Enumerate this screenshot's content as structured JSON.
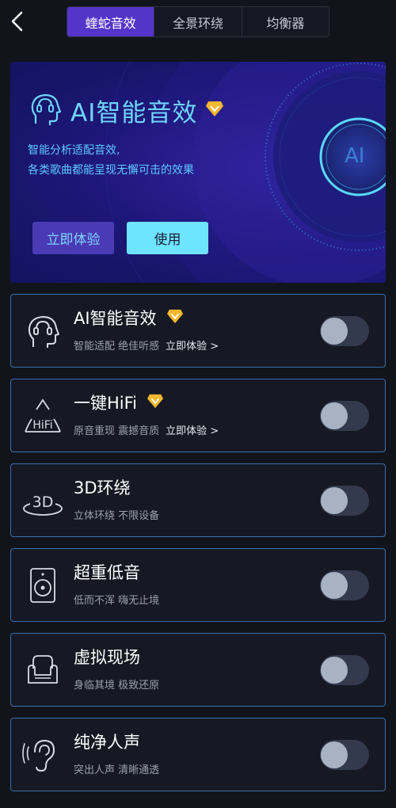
{
  "tabs": [
    {
      "label": "蝰蛇音效",
      "active": true
    },
    {
      "label": "全景环绕",
      "active": false
    },
    {
      "label": "均衡器",
      "active": false
    }
  ],
  "banner": {
    "title": "AI智能音效",
    "desc_line1": "智能分析适配音效,",
    "desc_line2": "各类歌曲都能呈现无懈可击的效果",
    "try_label": "立即体验",
    "use_label": "使用",
    "circle_label": "AI"
  },
  "effects": [
    {
      "title": "AI智能音效",
      "subtitle": "智能适配 绝佳听感",
      "link": "立即体验 >",
      "vip": true,
      "icon": "ai-head-icon",
      "enabled": false
    },
    {
      "title": "一键HiFi",
      "subtitle": "原音重现 震撼音质",
      "link": "立即体验 >",
      "vip": true,
      "icon": "hifi-icon",
      "icon_text": "HiFi",
      "enabled": false
    },
    {
      "title": "3D环绕",
      "subtitle": "立体环绕 不限设备",
      "vip": false,
      "icon": "3d-surround-icon",
      "icon_text": "3D",
      "enabled": false
    },
    {
      "title": "超重低音",
      "subtitle": "低而不浑 嗨无止境",
      "vip": false,
      "icon": "speaker-icon",
      "enabled": false
    },
    {
      "title": "虚拟现场",
      "subtitle": "身临其境 极致还原",
      "vip": false,
      "icon": "armchair-icon",
      "enabled": false
    },
    {
      "title": "纯净人声",
      "subtitle": "突出人声 清晰通透",
      "vip": false,
      "icon": "ear-icon",
      "enabled": false
    }
  ],
  "colors": {
    "background": "#12141c",
    "active_tab": "#5534c9",
    "accent": "#6fd6ff",
    "card_border": "#3a6ea8",
    "vip": "#f5b82e"
  }
}
